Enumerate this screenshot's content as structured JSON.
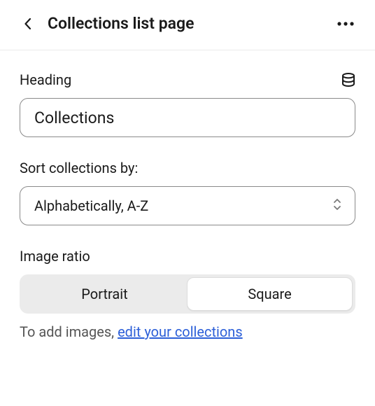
{
  "header": {
    "title": "Collections list page"
  },
  "heading": {
    "label": "Heading",
    "value": "Collections"
  },
  "sort": {
    "label": "Sort collections by:",
    "value": "Alphabetically, A-Z",
    "options": [
      "Alphabetically, A-Z"
    ]
  },
  "imageRatio": {
    "label": "Image ratio",
    "options": [
      "Portrait",
      "Square"
    ],
    "selected": "Square",
    "help_prefix": "To add images, ",
    "help_link": "edit your collections"
  }
}
